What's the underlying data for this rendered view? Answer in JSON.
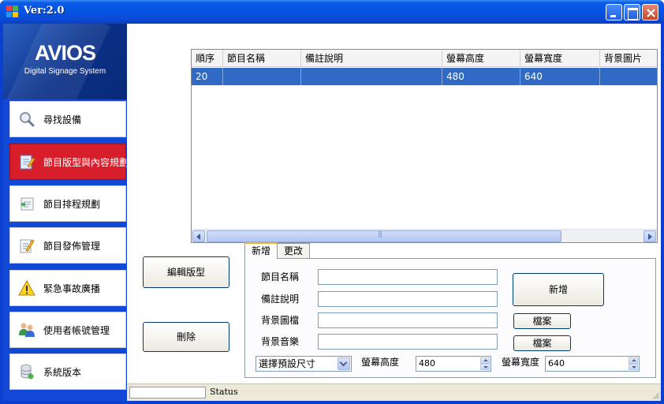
{
  "window": {
    "title": "Ver:2.0"
  },
  "logo": {
    "brand": "AVIOS",
    "tagline": "Digital Signage System"
  },
  "sidebar": {
    "items": [
      {
        "label": "尋找設備",
        "icon": "magnifier-icon",
        "active": false
      },
      {
        "label": "節目版型與內容規劃",
        "icon": "edit-document-icon",
        "active": true
      },
      {
        "label": "節目排程規劃",
        "icon": "schedule-list-icon",
        "active": false
      },
      {
        "label": "節目發佈管理",
        "icon": "publish-pencil-icon",
        "active": false
      },
      {
        "label": "緊急事故廣播",
        "icon": "warning-icon",
        "active": false
      },
      {
        "label": "使用者帳號管理",
        "icon": "users-icon",
        "active": false
      },
      {
        "label": "系統版本",
        "icon": "database-icon",
        "active": false
      }
    ]
  },
  "grid": {
    "columns": [
      "順序",
      "節目名稱",
      "備註說明",
      "螢幕高度",
      "螢幕寬度",
      "背景圖片"
    ],
    "rows": [
      [
        "20",
        "",
        "",
        "480",
        "640",
        ""
      ]
    ]
  },
  "actions": {
    "edit_layout": "編輯版型",
    "delete": "刪除"
  },
  "tabs": [
    {
      "label": "新增",
      "active": true
    },
    {
      "label": "更改",
      "active": false
    }
  ],
  "form": {
    "name_label": "節目名稱",
    "name_value": "",
    "note_label": "備註說明",
    "note_value": "",
    "bg_image_label": "背景圖檔",
    "bg_image_value": "",
    "bg_music_label": "背景音樂",
    "bg_music_value": "",
    "add_button": "新增",
    "file_button_1": "檔案",
    "file_button_2": "檔案",
    "preset_select": "選擇預設尺寸",
    "height_label": "螢幕高度",
    "height_value": "480",
    "width_label": "螢幕寬度",
    "width_value": "640"
  },
  "statusbar": {
    "text": "Status"
  }
}
